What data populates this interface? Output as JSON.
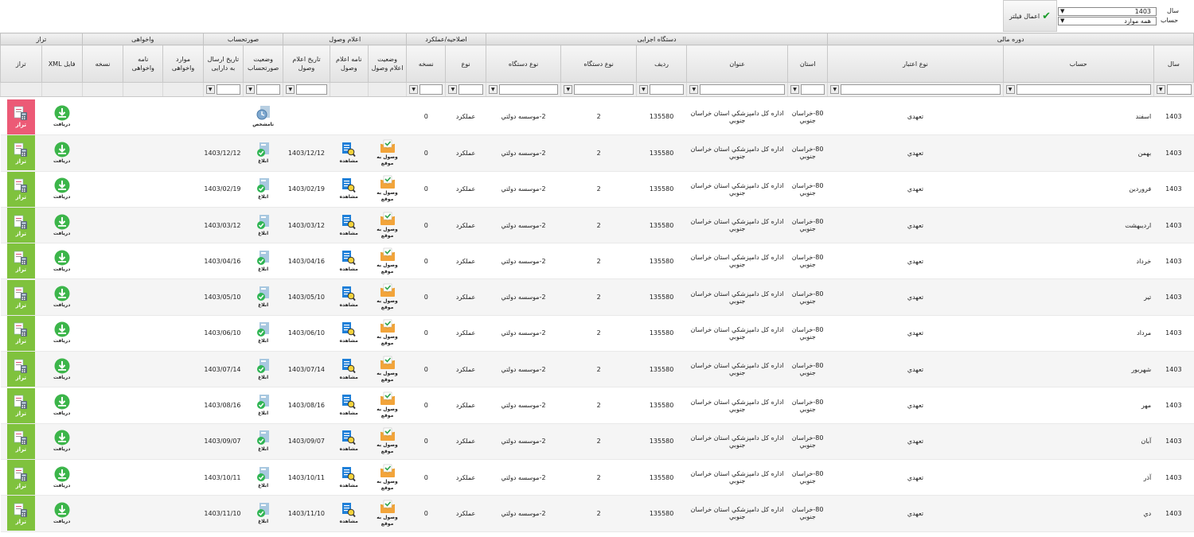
{
  "filter": {
    "year_label": "سال",
    "year_value": "1403",
    "account_label": "حساب",
    "account_value": "همه موارد",
    "apply_label": "اعمال فیلتر"
  },
  "groups": {
    "fiscal": "دوره مالی",
    "agency": "دستگاه اجرایی",
    "corrective": "اصلاحیه/عملکرد",
    "receipt": "اعلام وصول",
    "statement": "صورتحساب",
    "audit": "واخواهی",
    "balance": "تراز"
  },
  "columns": {
    "year": "سال",
    "account": "حساب",
    "credit_type": "نوع اعتبار",
    "province": "استان",
    "title": "عنوان",
    "row": "ردیف",
    "agency_code": "نوع دستگاه",
    "agency_type": "نوع دستگاه",
    "kind": "نوع",
    "version": "نسخه",
    "receipt_status": "وضعیت اعلام وصول",
    "receipt_letter": "نامه اعلام وصول",
    "receipt_date": "تاریخ اعلام وصول",
    "statement_status": "وضعیت صورتحساب",
    "statement_date": "تاریخ ارسال به دارایی",
    "audit_items": "موارد واخواهی",
    "audit_letter": "نامه واخواهی",
    "audit_version": "نسخه",
    "xml_file": "فایل XML",
    "balance": "تراز"
  },
  "rows": [
    {
      "year": "1403",
      "month": "اسفند",
      "credit": "تعهدی",
      "province": "80-خراسان جنوبي",
      "title": "اداره كل دامپزشكي استان خراسان جنوبي",
      "row": "135580",
      "code": "2",
      "agency": "2-موسسه دولتي",
      "kind": "عملكرد",
      "version": "0",
      "receipt_status": "",
      "receipt_date": "",
      "statement_status": "نامشخص",
      "statement_date": "",
      "download": "دریافت",
      "balance": "تراز"
    },
    {
      "year": "1403",
      "month": "بهمن",
      "credit": "تعهدي",
      "province": "80-خراسان جنوبي",
      "title": "اداره كل دامپزشكي استان خراسان جنوبي",
      "row": "135580",
      "code": "2",
      "agency": "2-موسسه دولتي",
      "kind": "عملكرد",
      "version": "0",
      "receipt_status": "وصول به موقع",
      "receipt_view": "مشاهده",
      "receipt_date": "1403/12/12",
      "statement_status": "ابلاغ",
      "statement_date": "1403/12/12",
      "download": "دریافت",
      "balance": "تراز"
    },
    {
      "year": "1403",
      "month": "فروردين",
      "credit": "تعهدي",
      "province": "80-خراسان جنوبي",
      "title": "اداره كل دامپزشكي استان خراسان جنوبي",
      "row": "135580",
      "code": "2",
      "agency": "2-موسسه دولتي",
      "kind": "عملكرد",
      "version": "0",
      "receipt_status": "وصول به موقع",
      "receipt_view": "مشاهده",
      "receipt_date": "1403/02/19",
      "statement_status": "ابلاغ",
      "statement_date": "1403/02/19",
      "download": "دریافت",
      "balance": "تراز"
    },
    {
      "year": "1403",
      "month": "ارديبهشت",
      "credit": "تعهدي",
      "province": "80-خراسان جنوبي",
      "title": "اداره كل دامپزشكي استان خراسان جنوبي",
      "row": "135580",
      "code": "2",
      "agency": "2-موسسه دولتي",
      "kind": "عملكرد",
      "version": "0",
      "receipt_status": "وصول به موقع",
      "receipt_view": "مشاهده",
      "receipt_date": "1403/03/12",
      "statement_status": "ابلاغ",
      "statement_date": "1403/03/12",
      "download": "دریافت",
      "balance": "تراز"
    },
    {
      "year": "1403",
      "month": "خرداد",
      "credit": "تعهدي",
      "province": "80-خراسان جنوبي",
      "title": "اداره كل دامپزشكي استان خراسان جنوبي",
      "row": "135580",
      "code": "2",
      "agency": "2-موسسه دولتي",
      "kind": "عملكرد",
      "version": "0",
      "receipt_status": "وصول به موقع",
      "receipt_view": "مشاهده",
      "receipt_date": "1403/04/16",
      "statement_status": "ابلاغ",
      "statement_date": "1403/04/16",
      "download": "دریافت",
      "balance": "تراز"
    },
    {
      "year": "1403",
      "month": "تير",
      "credit": "تعهدي",
      "province": "80-خراسان جنوبي",
      "title": "اداره كل دامپزشكي استان خراسان جنوبي",
      "row": "135580",
      "code": "2",
      "agency": "2-موسسه دولتي",
      "kind": "عملكرد",
      "version": "0",
      "receipt_status": "وصول به موقع",
      "receipt_view": "مشاهده",
      "receipt_date": "1403/05/10",
      "statement_status": "ابلاغ",
      "statement_date": "1403/05/10",
      "download": "دریافت",
      "balance": "تراز"
    },
    {
      "year": "1403",
      "month": "مرداد",
      "credit": "تعهدي",
      "province": "80-خراسان جنوبي",
      "title": "اداره كل دامپزشكي استان خراسان جنوبي",
      "row": "135580",
      "code": "2",
      "agency": "2-موسسه دولتي",
      "kind": "عملكرد",
      "version": "0",
      "receipt_status": "وصول به موقع",
      "receipt_view": "مشاهده",
      "receipt_date": "1403/06/10",
      "statement_status": "ابلاغ",
      "statement_date": "1403/06/10",
      "download": "دریافت",
      "balance": "تراز"
    },
    {
      "year": "1403",
      "month": "شهريور",
      "credit": "تعهدي",
      "province": "80-خراسان جنوبي",
      "title": "اداره كل دامپزشكي استان خراسان جنوبي",
      "row": "135580",
      "code": "2",
      "agency": "2-موسسه دولتي",
      "kind": "عملكرد",
      "version": "0",
      "receipt_status": "وصول به موقع",
      "receipt_view": "مشاهده",
      "receipt_date": "1403/07/14",
      "statement_status": "ابلاغ",
      "statement_date": "1403/07/14",
      "download": "دریافت",
      "balance": "تراز"
    },
    {
      "year": "1403",
      "month": "مهر",
      "credit": "تعهدي",
      "province": "80-خراسان جنوبي",
      "title": "اداره كل دامپزشكي استان خراسان جنوبي",
      "row": "135580",
      "code": "2",
      "agency": "2-موسسه دولتي",
      "kind": "عملكرد",
      "version": "0",
      "receipt_status": "وصول به موقع",
      "receipt_view": "مشاهده",
      "receipt_date": "1403/08/16",
      "statement_status": "ابلاغ",
      "statement_date": "1403/08/16",
      "download": "دریافت",
      "balance": "تراز"
    },
    {
      "year": "1403",
      "month": "آبان",
      "credit": "تعهدي",
      "province": "80-خراسان جنوبي",
      "title": "اداره كل دامپزشكي استان خراسان جنوبي",
      "row": "135580",
      "code": "2",
      "agency": "2-موسسه دولتي",
      "kind": "عملكرد",
      "version": "0",
      "receipt_status": "وصول به موقع",
      "receipt_view": "مشاهده",
      "receipt_date": "1403/09/07",
      "statement_status": "ابلاغ",
      "statement_date": "1403/09/07",
      "download": "دریافت",
      "balance": "تراز"
    },
    {
      "year": "1403",
      "month": "آذر",
      "credit": "تعهدي",
      "province": "80-خراسان جنوبي",
      "title": "اداره كل دامپزشكي استان خراسان جنوبي",
      "row": "135580",
      "code": "2",
      "agency": "2-موسسه دولتي",
      "kind": "عملكرد",
      "version": "0",
      "receipt_status": "وصول به موقع",
      "receipt_view": "مشاهده",
      "receipt_date": "1403/10/11",
      "statement_status": "ابلاغ",
      "statement_date": "1403/10/11",
      "download": "دریافت",
      "balance": "تراز"
    },
    {
      "year": "1403",
      "month": "دي",
      "credit": "تعهدي",
      "province": "80-خراسان جنوبي",
      "title": "اداره كل دامپزشكي استان خراسان جنوبي",
      "row": "135580",
      "code": "2",
      "agency": "2-موسسه دولتي",
      "kind": "عملكرد",
      "version": "0",
      "receipt_status": "وصول به موقع",
      "receipt_view": "مشاهده",
      "receipt_date": "1403/11/10",
      "statement_status": "ابلاغ",
      "statement_date": "1403/11/10",
      "download": "دریافت",
      "balance": "تراز"
    }
  ]
}
